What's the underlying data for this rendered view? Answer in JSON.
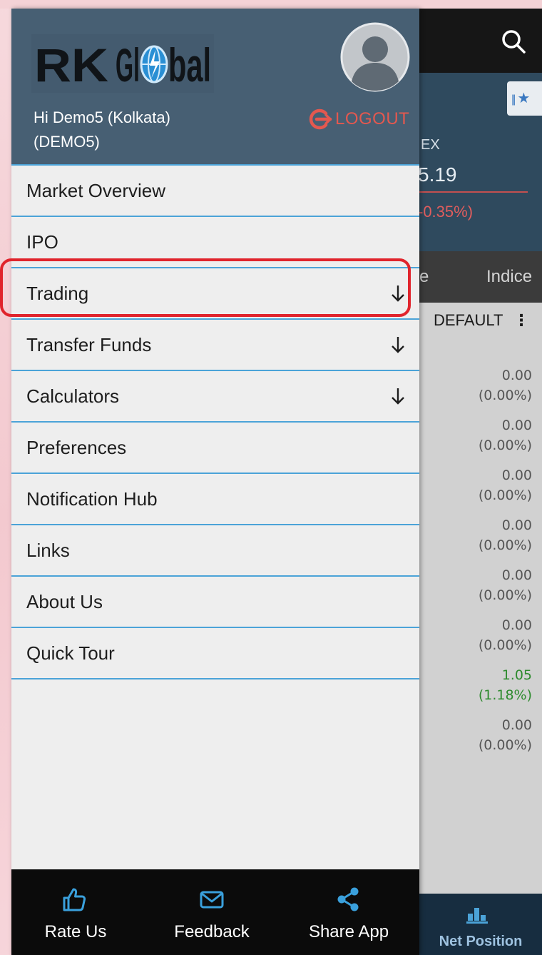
{
  "background_app": {
    "index_name": "EX",
    "index_value": "5.19",
    "index_change": "-0.35%)",
    "tab_partial": "e",
    "tab_indices": "Indice",
    "watchlist_name": "DEFAULT",
    "watchlist_menu": "⋮",
    "quotes": [
      {
        "value": "0.00",
        "change": "(0.00%)",
        "direction": "neutral"
      },
      {
        "value": "0.00",
        "change": "(0.00%)",
        "direction": "neutral"
      },
      {
        "value": "0.00",
        "change": "(0.00%)",
        "direction": "neutral"
      },
      {
        "value": "0.00",
        "change": "(0.00%)",
        "direction": "neutral"
      },
      {
        "value": "0.00",
        "change": "(0.00%)",
        "direction": "neutral"
      },
      {
        "value": "0.00",
        "change": "(0.00%)",
        "direction": "neutral"
      },
      {
        "value": "1.05",
        "change": "(1.18%)",
        "direction": "up"
      },
      {
        "value": "0.00",
        "change": "(0.00%)",
        "direction": "neutral"
      }
    ],
    "bottom_tab": "Net Position"
  },
  "drawer": {
    "logo_text": "R K Gl bal",
    "greeting_line1": "Hi Demo5 (Kolkata)",
    "greeting_line2": "(DEMO5)",
    "logout_label": "LOGOUT",
    "menu": [
      {
        "label": "Market Overview",
        "name": "menu-item-market-overview",
        "expandable": false
      },
      {
        "label": "IPO",
        "name": "menu-item-ipo",
        "expandable": false
      },
      {
        "label": "Trading",
        "name": "menu-item-trading",
        "expandable": true
      },
      {
        "label": "Transfer Funds",
        "name": "menu-item-transfer-funds",
        "expandable": true
      },
      {
        "label": "Calculators",
        "name": "menu-item-calculators",
        "expandable": true
      },
      {
        "label": "Preferences",
        "name": "menu-item-preferences",
        "expandable": false
      },
      {
        "label": "Notification Hub",
        "name": "menu-item-notification-hub",
        "expandable": false
      },
      {
        "label": "Links",
        "name": "menu-item-links",
        "expandable": false
      },
      {
        "label": "About Us",
        "name": "menu-item-about-us",
        "expandable": false
      },
      {
        "label": "Quick Tour",
        "name": "menu-item-quick-tour",
        "expandable": false
      }
    ],
    "highlighted_item": "Trading",
    "footer": {
      "rate_us": "Rate Us",
      "feedback": "Feedback",
      "share_app": "Share App"
    }
  },
  "colors": {
    "header_bg": "#475f73",
    "divider": "#4ba3d8",
    "logout": "#e4584f",
    "highlight": "#e0242c",
    "positive": "#2e8b2e",
    "footer_icon": "#3aa0dc"
  },
  "icons": [
    "search-icon",
    "star-icon",
    "avatar-icon",
    "logout-icon",
    "arrow-down-icon",
    "thumbs-up-icon",
    "mail-icon",
    "share-icon",
    "bar-chart-icon"
  ]
}
